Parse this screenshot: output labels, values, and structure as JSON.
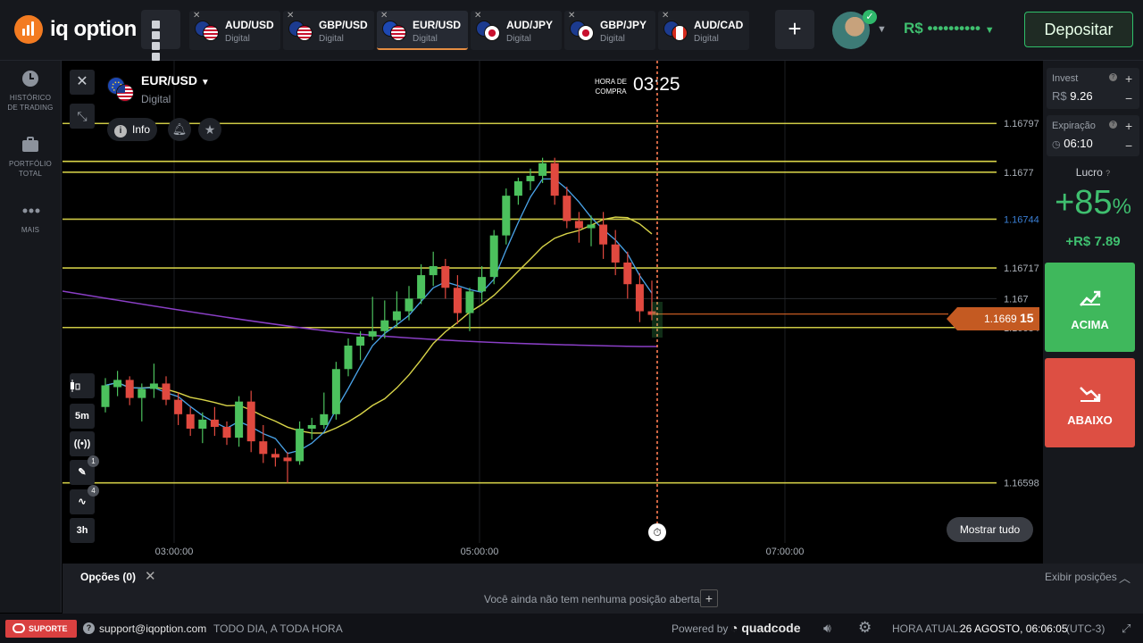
{
  "brand": {
    "name": "iq option"
  },
  "top_tabs": [
    {
      "symbol": "AUD/USD",
      "type": "Digital",
      "active": false
    },
    {
      "symbol": "GBP/USD",
      "type": "Digital",
      "active": false
    },
    {
      "symbol": "EUR/USD",
      "type": "Digital",
      "active": true
    },
    {
      "symbol": "AUD/JPY",
      "type": "Digital",
      "active": false
    },
    {
      "symbol": "GBP/JPY",
      "type": "Digital",
      "active": false
    },
    {
      "symbol": "AUD/CAD",
      "type": "Digital",
      "active": false
    }
  ],
  "account": {
    "balance": "R$ ••••••••••",
    "deposit_label": "Depositar"
  },
  "left_nav": [
    {
      "icon": "clock-icon",
      "label1": "HISTÓRICO",
      "label2": "DE TRADING"
    },
    {
      "icon": "briefcase-icon",
      "label1": "PORTFÓLIO",
      "label2": "TOTAL"
    },
    {
      "icon": "more-icon",
      "label1": "MAIS",
      "label2": ""
    }
  ],
  "chart_header": {
    "asset": "EUR/USD",
    "asset_type": "Digital",
    "info_label": "Info",
    "buy_time_label_1": "HORA DE",
    "buy_time_label_2": "COMPRA",
    "buy_time": "03:25",
    "show_all": "Mostrar tudo"
  },
  "chart_tools": {
    "timeframe": "5m",
    "zoom": "3h",
    "drawings_count": "1",
    "indicators_count": "4"
  },
  "chart_data": {
    "type": "candlestick",
    "x_ticks": [
      "03:00:00",
      "05:00:00",
      "07:00:00"
    ],
    "price_levels": [
      {
        "price": 1.16797,
        "label": "1.16797",
        "style": "yellow"
      },
      {
        "price": 1.1677,
        "label": "1.1677",
        "style": "yellow"
      },
      {
        "price": 1.16744,
        "label": "1.16744",
        "style": "yellow"
      },
      {
        "price": 1.16717,
        "label": "1.16717",
        "style": "yellow"
      },
      {
        "price": 1.167,
        "label": "1.167",
        "style": "grid"
      },
      {
        "price": 1.16684,
        "label": "1.16684",
        "style": "yellow"
      },
      {
        "price": 1.16598,
        "label": "1.16598",
        "style": "yellow"
      }
    ],
    "current_price": {
      "main": "1.1669",
      "highlight": "15"
    },
    "candles_note": "approximate EUR/USD 5m candles read from the chart",
    "candles": [
      [
        1.1664,
        1.16656,
        1.16637,
        1.16652
      ],
      [
        1.16651,
        1.1666,
        1.16646,
        1.16655
      ],
      [
        1.16655,
        1.16657,
        1.16641,
        1.16645
      ],
      [
        1.16645,
        1.16653,
        1.16632,
        1.1665
      ],
      [
        1.1665,
        1.16664,
        1.16645,
        1.16653
      ],
      [
        1.16653,
        1.16657,
        1.16641,
        1.16644
      ],
      [
        1.16644,
        1.16648,
        1.1663,
        1.16636
      ],
      [
        1.16636,
        1.1664,
        1.16624,
        1.16628
      ],
      [
        1.16628,
        1.16637,
        1.1662,
        1.16633
      ],
      [
        1.16633,
        1.1664,
        1.16624,
        1.16629
      ],
      [
        1.16629,
        1.16632,
        1.16619,
        1.16623
      ],
      [
        1.16623,
        1.16646,
        1.16618,
        1.16643
      ],
      [
        1.16643,
        1.16649,
        1.16615,
        1.16621
      ],
      [
        1.16621,
        1.1663,
        1.16609,
        1.16614
      ],
      [
        1.16614,
        1.16617,
        1.16607,
        1.16612
      ],
      [
        1.16612,
        1.16615,
        1.16598,
        1.1661
      ],
      [
        1.1661,
        1.16632,
        1.16608,
        1.16628
      ],
      [
        1.16628,
        1.16634,
        1.16622,
        1.1663
      ],
      [
        1.1663,
        1.16648,
        1.16628,
        1.16636
      ],
      [
        1.16636,
        1.16665,
        1.16633,
        1.16661
      ],
      [
        1.16661,
        1.16678,
        1.16657,
        1.16674
      ],
      [
        1.16674,
        1.16682,
        1.16666,
        1.16679
      ],
      [
        1.16679,
        1.16701,
        1.16677,
        1.16682
      ],
      [
        1.16682,
        1.16699,
        1.16678,
        1.16688
      ],
      [
        1.16688,
        1.16704,
        1.16684,
        1.16693
      ],
      [
        1.16693,
        1.16707,
        1.16688,
        1.167
      ],
      [
        1.167,
        1.16719,
        1.16697,
        1.16713
      ],
      [
        1.16713,
        1.16726,
        1.16707,
        1.16718
      ],
      [
        1.16718,
        1.16722,
        1.167,
        1.16706
      ],
      [
        1.16706,
        1.16713,
        1.16686,
        1.16692
      ],
      [
        1.16692,
        1.16706,
        1.16682,
        1.16704
      ],
      [
        1.16704,
        1.16718,
        1.16698,
        1.16712
      ],
      [
        1.16712,
        1.16738,
        1.16708,
        1.16735
      ],
      [
        1.16735,
        1.16761,
        1.1673,
        1.16757
      ],
      [
        1.16757,
        1.16767,
        1.16752,
        1.16765
      ],
      [
        1.16765,
        1.16772,
        1.1676,
        1.16768
      ],
      [
        1.16768,
        1.16778,
        1.16764,
        1.16775
      ],
      [
        1.16775,
        1.16778,
        1.16752,
        1.16757
      ],
      [
        1.16757,
        1.16762,
        1.16739,
        1.16743
      ],
      [
        1.16743,
        1.16748,
        1.16731,
        1.16739
      ],
      [
        1.16739,
        1.16746,
        1.16729,
        1.16741
      ],
      [
        1.16741,
        1.16748,
        1.16722,
        1.1673
      ],
      [
        1.1673,
        1.16738,
        1.16713,
        1.1672
      ],
      [
        1.1672,
        1.16726,
        1.167,
        1.16708
      ],
      [
        1.16708,
        1.16714,
        1.16687,
        1.16693
      ],
      [
        1.16693,
        1.1671,
        1.16688,
        1.16691
      ]
    ]
  },
  "trade_panel": {
    "invest_label": "Invest",
    "invest_currency": "R$",
    "invest_value": "9.26",
    "expiry_label": "Expiração",
    "expiry_value": "06:10",
    "profit_label": "Lucro",
    "profit_pct": "+85",
    "profit_pct_sign": "%",
    "profit_value": "+R$ 7.89",
    "up_label": "ACIMA",
    "down_label": "ABAIXO"
  },
  "positions": {
    "tab_label": "Opções (0)",
    "expand_label": "Exibir posições",
    "empty_text": "Você ainda não tem nenhuma posição aberta"
  },
  "footer": {
    "support_label": "SUPORTE",
    "email": "support@iqoption.com",
    "availability": "TODO DIA, A TODA HORA",
    "powered_by": "Powered by",
    "powered_brand": "quadcode",
    "clock_label": "HORA ATUAL:",
    "clock_value": "26 AGOSTO, 06:06:05",
    "timezone": "(UTC-3)"
  },
  "colors": {
    "accent_orange": "#f37b21",
    "up_green": "#3fb85c",
    "down_red": "#dd4f43",
    "level_yellow": "#d8d449"
  }
}
